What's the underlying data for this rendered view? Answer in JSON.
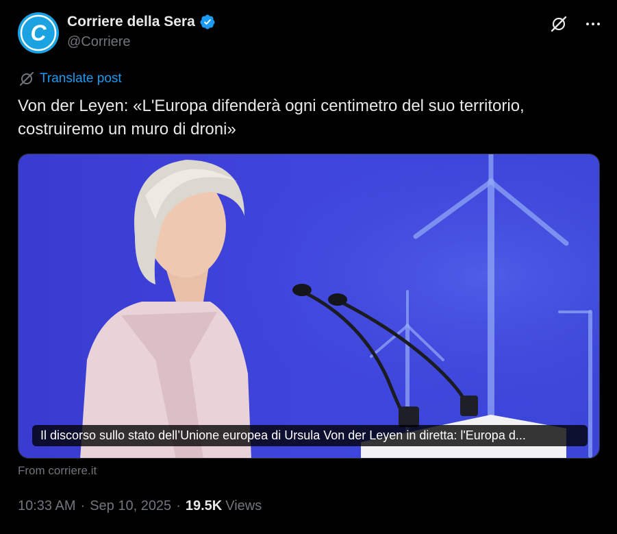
{
  "author": {
    "display_name": "Corriere della Sera",
    "handle": "@Corriere",
    "avatar_letter": "C",
    "verified": true
  },
  "actions": {
    "grok_icon": "grok-icon",
    "more_icon": "more-icon"
  },
  "translate": {
    "label": "Translate post",
    "icon": "translate-icon"
  },
  "post": {
    "text": "Von der Leyen: «L'Europa difenderà ogni centimetro del suo territorio, costruiremo un muro di droni»"
  },
  "card": {
    "caption": "Il discorso sullo stato dell’Unione europea di Ursula Von der Leyen in diretta: l'Europa d...",
    "source": "From corriere.it"
  },
  "meta": {
    "time": "10:33 AM",
    "separator": "·",
    "date": "Sep 10, 2025",
    "views_count": "19.5K",
    "views_label": "Views"
  },
  "colors": {
    "background": "#000000",
    "text": "#e7e9ea",
    "secondary": "#71767b",
    "link": "#1d9bf0",
    "avatar": "#1aa3e0",
    "photo_bg": "#3b3fd6"
  }
}
